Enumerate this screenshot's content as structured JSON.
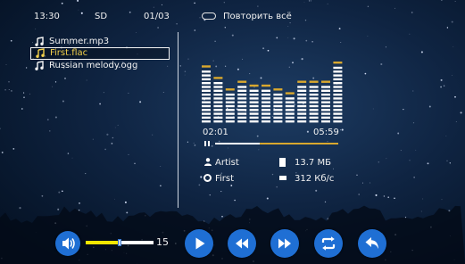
{
  "status": {
    "time": "13:30",
    "source": "SD",
    "track_counter": "01/03",
    "repeat_label": "Повторить всё"
  },
  "playlist": [
    {
      "name": "Summer.mp3",
      "selected": false
    },
    {
      "name": "First.flac",
      "selected": true
    },
    {
      "name": "Russian melody.ogg",
      "selected": false
    }
  ],
  "equalizer": {
    "levels": [
      0.93,
      0.7,
      0.55,
      0.64,
      0.6,
      0.6,
      0.53,
      0.44,
      0.64,
      0.64,
      0.64,
      1.0
    ],
    "bar_color": "#ffffff",
    "peak_color": "#d9a82e"
  },
  "player": {
    "elapsed": "02:01",
    "duration": "05:59",
    "progress": 0.36,
    "state": "playing"
  },
  "track_info": {
    "artist": "Artist",
    "album": "First",
    "file_size": "13.7 МБ",
    "bitrate": "312 Кб/с"
  },
  "controls": {
    "volume": {
      "value": "15",
      "level": 0.5
    },
    "buttons": [
      "play-icon",
      "rewind-icon",
      "fast-forward-icon",
      "repeat-icon",
      "back-icon"
    ],
    "accent_color": "#1f6fd4",
    "volume_color": "#f5e600"
  }
}
